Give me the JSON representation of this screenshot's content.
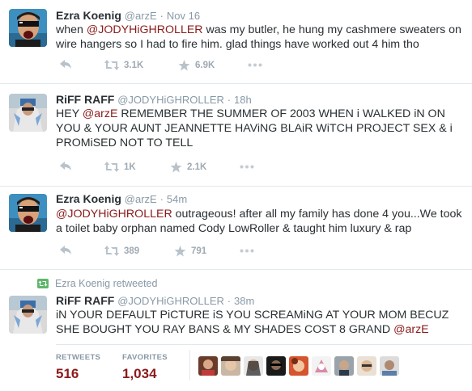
{
  "tweets": [
    {
      "name": "Ezra Koenig",
      "handle": "@arzE",
      "sep": "·",
      "time": "Nov 16",
      "text_a": "when ",
      "mention_a": "@JODYHiGHROLLER",
      "text_b": " was my butler, he hung my cashmere sweaters on wire hangers so I had to fire him. glad things have worked out 4 him tho",
      "retweets": "3.1K",
      "favorites": "6.9K"
    },
    {
      "name": "RiFF RAFF",
      "handle": "@JODYHiGHROLLER",
      "sep": "·",
      "time": "18h",
      "text_a": "HEY ",
      "mention_a": "@arzE",
      "text_b": " REMEMBER THE SUMMER OF 2003 WHEN i WALKED iN ON YOU & YOUR AUNT JEANNETTE HAViNG BLAiR WiTCH PROJECT SEX & i PROMiSED NOT TO TELL",
      "retweets": "1K",
      "favorites": "2.1K"
    },
    {
      "name": "Ezra Koenig",
      "handle": "@arzE",
      "sep": "·",
      "time": "54m",
      "text_a": "",
      "mention_a": "@JODYHiGHROLLER",
      "text_b": " outrageous! after all my family has done 4 you...We took a toilet baby orphan named Cody LowRoller & taught him luxury & rap",
      "retweets": "389",
      "favorites": "791"
    },
    {
      "retweeted_by": "Ezra Koenig retweeted",
      "name": "RiFF RAFF",
      "handle": "@JODYHiGHROLLER",
      "sep": "·",
      "time": "38m",
      "text_a": "iN YOUR DEFAULT PiCTURE iS YOU SCREAMiNG AT YOUR MOM BECUZ SHE BOUGHT YOU RAY BANS & MY SHADES COST 8 GRAND ",
      "mention_a": "@arzE",
      "text_b": "",
      "stats": {
        "retweets_label": "RETWEETS",
        "retweets": "516",
        "favorites_label": "FAVORITES",
        "favorites": "1,034"
      }
    }
  ],
  "colors": {
    "mention": "#8b1a1a",
    "meta": "#8899a6",
    "action": "#a0aab3",
    "retweet_green": "#5fb66b"
  },
  "icons": [
    "reply-icon",
    "retweet-icon",
    "favorite-star-icon",
    "more-icon"
  ]
}
